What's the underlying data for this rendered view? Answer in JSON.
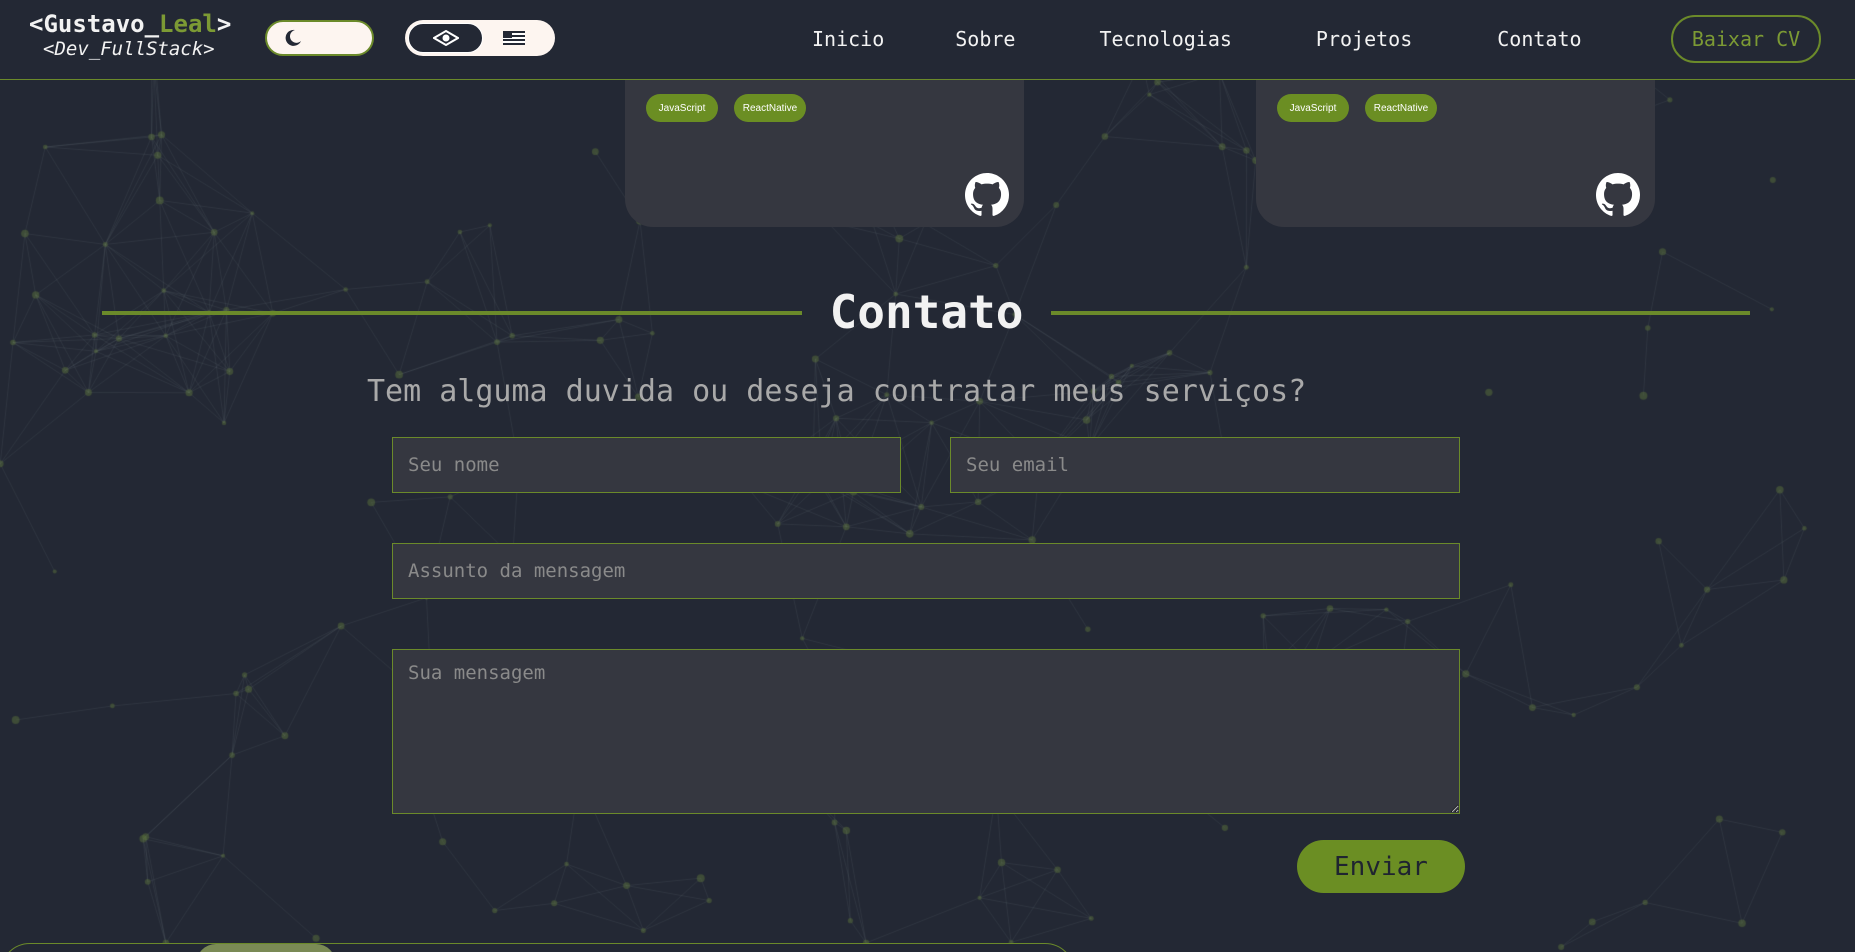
{
  "header": {
    "logo_main_prefix": "<Gustavo_",
    "logo_main_accent": "Leal",
    "logo_main_suffix": ">",
    "logo_sub": "<Dev_FullStack>",
    "theme_icon": "moon-icon",
    "lang_options": [
      "brazil-flag-icon",
      "us-flag-icon"
    ],
    "nav": [
      "Inicio",
      "Sobre",
      "Tecnologias",
      "Projetos",
      "Contato"
    ],
    "cv_label": "Baixar CV"
  },
  "projects": [
    {
      "tags": [
        "JavaScript",
        "ReactNative"
      ],
      "link_icon": "github-icon"
    },
    {
      "tags": [
        "JavaScript",
        "ReactNative"
      ],
      "link_icon": "github-icon"
    }
  ],
  "contact": {
    "title": "Contato",
    "subtitle": "Tem alguma duvida ou deseja contratar meus serviços?",
    "name_placeholder": "Seu nome",
    "email_placeholder": "Seu email",
    "subject_placeholder": "Assunto da mensagem",
    "message_placeholder": "Sua mensagem",
    "send_label": "Enviar"
  },
  "colors": {
    "background": "#232834",
    "accent": "#6b8e23",
    "card": "#353740",
    "text": "#f2f2f2"
  }
}
